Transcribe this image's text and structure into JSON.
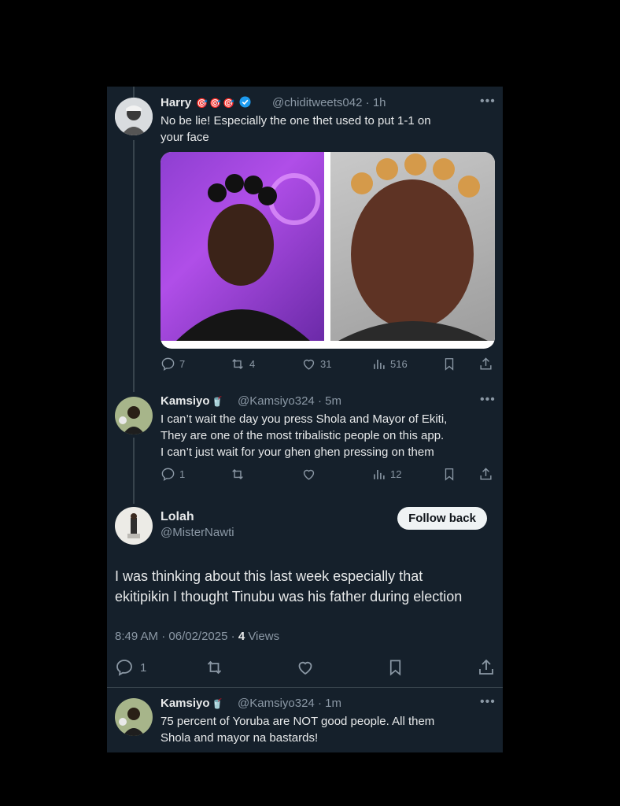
{
  "tweet1": {
    "name": "Harry",
    "handle": "@chiditweets042",
    "time": "1h",
    "text_line1": "No be lie! Especially the one thet used to put 1-1 on",
    "text_line2": "your face",
    "replies": "7",
    "reposts": "4",
    "likes": "31",
    "views": "516"
  },
  "tweet2": {
    "name": "Kamsiyo",
    "handle": "@Kamsiyo324",
    "time": "5m",
    "text_line1": "I can’t wait the day you press Shola and Mayor of Ekiti,",
    "text_line2": "They are one of the most tribalistic people on this app.",
    "text_line3": "I can’t just wait for your ghen ghen pressing on them",
    "replies": "1",
    "views": "12"
  },
  "main_tweet": {
    "name": "Lolah",
    "handle": "@MisterNawti",
    "follow_label": "Follow back",
    "text_line1": "I was thinking about this last week especially that",
    "text_line2": "ekitipikin I thought Tinubu was his father during election",
    "time": "8:49 AM",
    "date": "06/02/2025",
    "views_count": "4",
    "views_label": "Views",
    "replies": "1"
  },
  "tweet3": {
    "name": "Kamsiyo",
    "handle": "@Kamsiyo324",
    "time": "1m",
    "text_line1": "75 percent of Yoruba are NOT good people. All them",
    "text_line2": "Shola and mayor na bastards!"
  },
  "colors": {
    "background": "#15202b",
    "text_primary": "#e7e9ea",
    "text_secondary": "#8b98a5",
    "verified": "#1d9bf0"
  }
}
